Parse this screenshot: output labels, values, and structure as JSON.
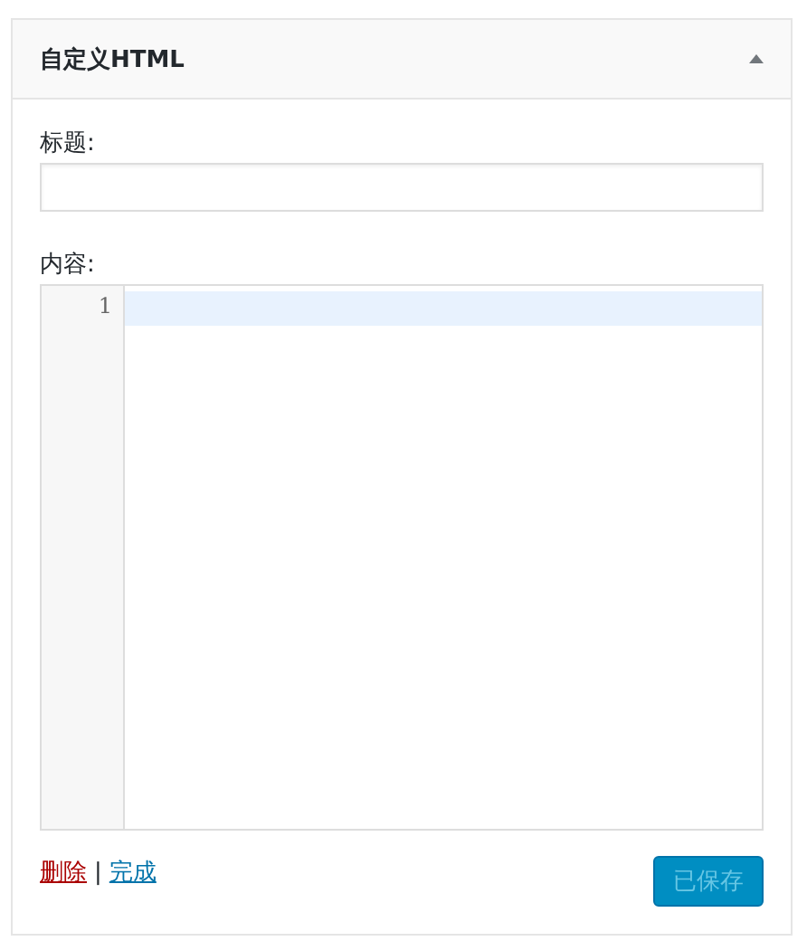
{
  "widget": {
    "title": "自定义HTML",
    "expanded": true
  },
  "fields": {
    "title_label": "标题:",
    "content_label": "内容:",
    "line_numbers": [
      "1"
    ]
  },
  "footer": {
    "delete_link": "删除",
    "separator": "|",
    "done_link": "完成",
    "save_button": {
      "label": "已保存",
      "disabled": true
    }
  }
}
